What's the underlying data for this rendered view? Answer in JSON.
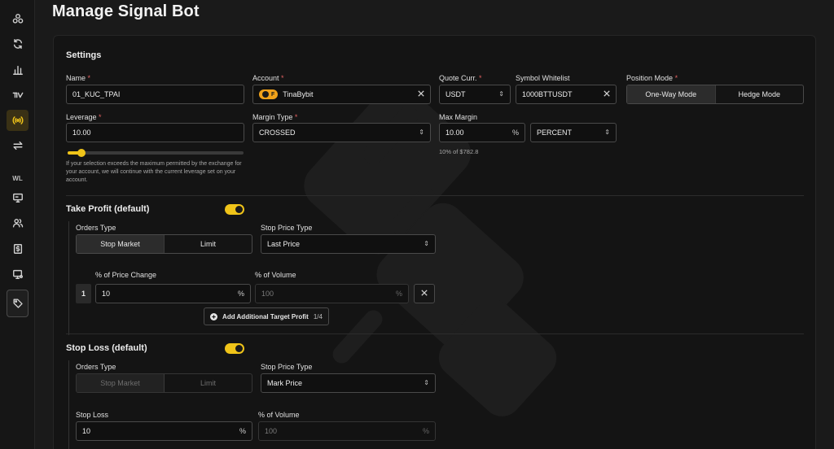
{
  "page": {
    "title": "Manage Signal Bot"
  },
  "sidebar": {
    "icons": [
      "bots-icon",
      "refresh-icon",
      "chart-bars-icon",
      "tradingview-icon",
      "signal-icon",
      "swap-icon",
      "monitor-icon",
      "users-icon",
      "dollar-doc-icon",
      "monitor-gear-icon",
      "tag-icon"
    ],
    "section_label": "WL"
  },
  "settings": {
    "title": "Settings",
    "name": {
      "label": "Name",
      "value": "01_KUC_TPAI"
    },
    "account": {
      "label": "Account",
      "badge": "F",
      "value": "TinaBybit"
    },
    "quote_currency": {
      "label": "Quote Curr.",
      "value": "USDT"
    },
    "symbol_whitelist": {
      "label": "Symbol Whitelist",
      "value": "1000BTTUSDT"
    },
    "position_mode": {
      "label": "Position Mode",
      "options": [
        "One-Way Mode",
        "Hedge Mode"
      ],
      "selected": "One-Way Mode"
    },
    "leverage": {
      "label": "Leverage",
      "value": "10.00",
      "slider_fraction": 0.08,
      "helper": "If your selection exceeds the maximum permitted by the exchange for your account, we will continue with the current leverage set on your account."
    },
    "margin_type": {
      "label": "Margin Type",
      "value": "CROSSED"
    },
    "max_margin": {
      "label": "Max Margin",
      "value": "10.00",
      "suffix": "%",
      "unit": "PERCENT",
      "helper": "10% of $782.8"
    }
  },
  "take_profit": {
    "title": "Take Profit (default)",
    "enabled": true,
    "orders_type": {
      "label": "Orders Type",
      "options": [
        "Stop Market",
        "Limit"
      ],
      "selected": "Stop Market"
    },
    "stop_price_type": {
      "label": "Stop Price Type",
      "value": "Last Price"
    },
    "targets": [
      {
        "index": "1",
        "price_change_label": "% of Price Change",
        "price_change": "10",
        "volume_label": "% of Volume",
        "volume_placeholder": "100",
        "suffix": "%"
      }
    ],
    "add_button": {
      "label": "Add Additional Target Profit",
      "count": "1/4"
    }
  },
  "stop_loss": {
    "title": "Stop Loss (default)",
    "enabled": true,
    "orders_type": {
      "label": "Orders Type",
      "options": [
        "Stop Market",
        "Limit"
      ],
      "selected": "Stop Market"
    },
    "stop_price_type": {
      "label": "Stop Price Type",
      "value": "Mark Price"
    },
    "stop_loss": {
      "label": "Stop Loss",
      "value": "10",
      "suffix": "%"
    },
    "volume": {
      "label": "% of Volume",
      "placeholder": "100",
      "suffix": "%"
    }
  },
  "colors": {
    "accent": "#f0c419",
    "required": "#e06060",
    "background": "#1a1a1a",
    "card": "#141414"
  }
}
